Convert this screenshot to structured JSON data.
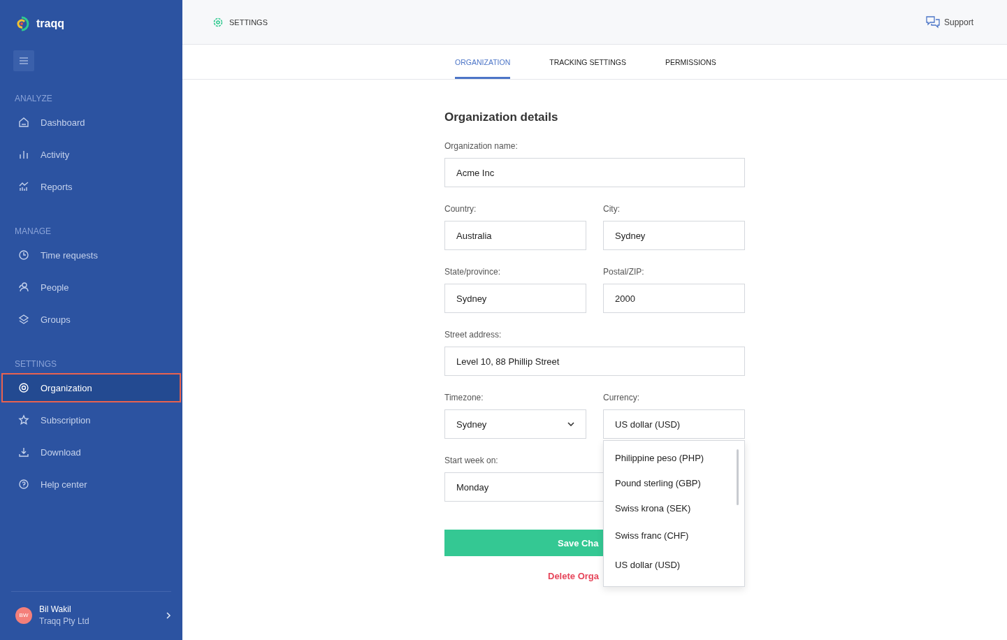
{
  "sidebar": {
    "logo": "traqq",
    "sections": [
      {
        "title": "ANALYZE",
        "items": [
          {
            "label": "Dashboard",
            "selected": false
          },
          {
            "label": "Activity",
            "selected": false
          },
          {
            "label": "Reports",
            "selected": false
          }
        ]
      },
      {
        "title": "MANAGE",
        "items": [
          {
            "label": "Time requests",
            "selected": false
          },
          {
            "label": "People",
            "selected": false
          },
          {
            "label": "Groups",
            "selected": false
          }
        ]
      },
      {
        "title": "SETTINGS",
        "items": [
          {
            "label": "Organization",
            "selected": true
          },
          {
            "label": "Subscription",
            "selected": false
          },
          {
            "label": "Download",
            "selected": false
          },
          {
            "label": "Help center",
            "selected": false
          }
        ]
      }
    ],
    "user": {
      "initials": "BW",
      "name": "Bil Wakil",
      "company": "Traqq Pty Ltd"
    }
  },
  "header": {
    "title": "SETTINGS",
    "support": "Support"
  },
  "tabs": [
    {
      "label": "ORGANIZATION",
      "selected": true
    },
    {
      "label": "TRACKING SETTINGS",
      "selected": false
    },
    {
      "label": "PERMISSIONS",
      "selected": false
    }
  ],
  "form": {
    "heading": "Organization details",
    "rows": [
      [
        {
          "label": "Organization name:",
          "value": "Acme Inc",
          "kind": "text"
        }
      ],
      [
        {
          "label": "Country:",
          "value": "Australia",
          "kind": "text"
        },
        {
          "label": "City:",
          "value": "Sydney",
          "kind": "text"
        }
      ],
      [
        {
          "label": "State/province:",
          "value": "Sydney",
          "kind": "text"
        },
        {
          "label": "Postal/ZIP:",
          "value": "2000",
          "kind": "text"
        }
      ],
      [
        {
          "label": "Street address:",
          "value": "Level 10, 88 Phillip Street",
          "kind": "text"
        }
      ],
      [
        {
          "label": "Timezone:",
          "value": "Sydney",
          "kind": "select"
        },
        {
          "label": "Currency:",
          "value": "US dollar (USD)",
          "kind": "open-select"
        }
      ],
      [
        {
          "label": "Start week on:",
          "value": "Monday",
          "kind": "text"
        }
      ]
    ],
    "currency_options": [
      "Philippine peso (PHP)",
      "Pound sterling (GBP)",
      "Swiss krona (SEK)",
      "Swiss franc (CHF)",
      "US dollar (USD)"
    ],
    "save_button": "Save Cha",
    "delete_link": "Delete Orga"
  }
}
